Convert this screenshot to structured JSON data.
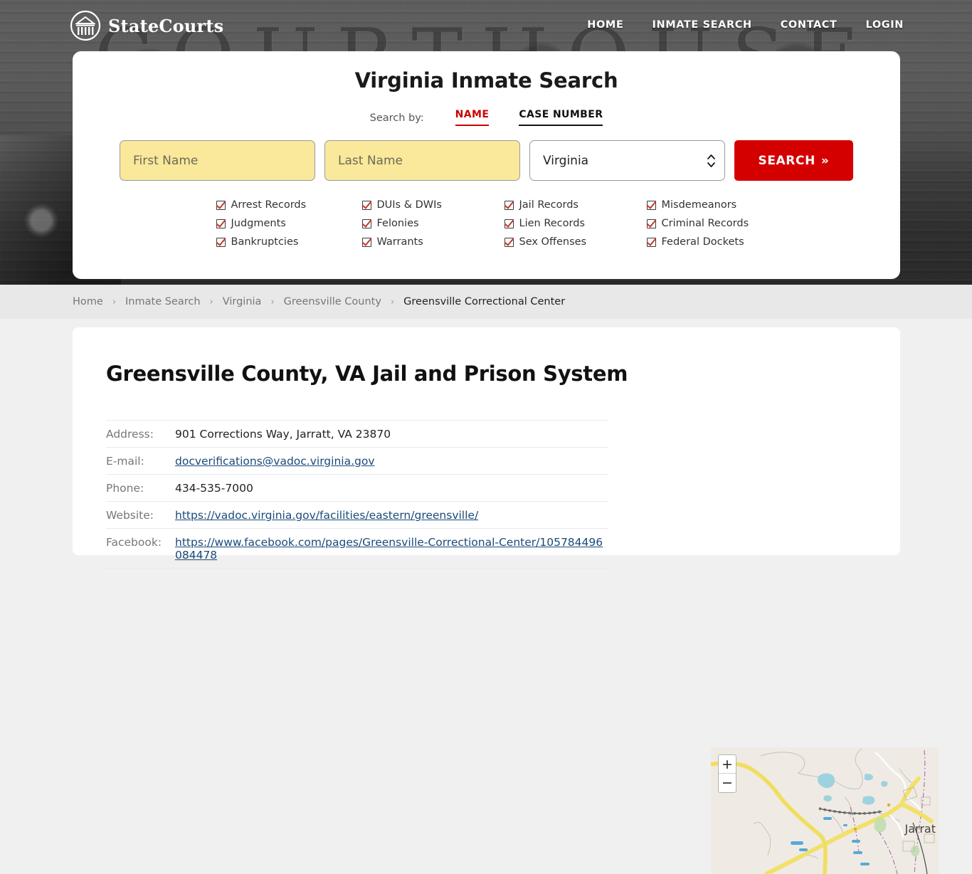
{
  "brand": {
    "name": "StateCourts",
    "logo_icon": "courthouse-circle-icon"
  },
  "topnav": [
    {
      "label": "HOME"
    },
    {
      "label": "INMATE SEARCH"
    },
    {
      "label": "CONTACT"
    },
    {
      "label": "LOGIN"
    }
  ],
  "search": {
    "title": "Virginia Inmate Search",
    "search_by_label": "Search by:",
    "tabs": [
      {
        "label": "NAME",
        "active": true,
        "color": "#cc0000"
      },
      {
        "label": "CASE NUMBER",
        "active": false,
        "color": "#111111"
      }
    ],
    "first_name_placeholder": "First Name",
    "first_name_value": "",
    "last_name_placeholder": "Last Name",
    "last_name_value": "",
    "state_selected": "Virginia",
    "state_options": [
      "Virginia"
    ],
    "submit_label": "SEARCH",
    "submit_chevron": "»",
    "field_color": "#fae89b",
    "button_color": "#d40000"
  },
  "record_types": [
    {
      "label": "Arrest Records",
      "checked": true
    },
    {
      "label": "DUIs & DWIs",
      "checked": true
    },
    {
      "label": "Jail Records",
      "checked": true
    },
    {
      "label": "Misdemeanors",
      "checked": true
    },
    {
      "label": "Judgments",
      "checked": true
    },
    {
      "label": "Felonies",
      "checked": true
    },
    {
      "label": "Lien Records",
      "checked": true
    },
    {
      "label": "Criminal Records",
      "checked": true
    },
    {
      "label": "Bankruptcies",
      "checked": true
    },
    {
      "label": "Warrants",
      "checked": true
    },
    {
      "label": "Sex Offenses",
      "checked": true
    },
    {
      "label": "Federal Dockets",
      "checked": true
    }
  ],
  "breadcrumb": [
    {
      "label": "Home",
      "current": false
    },
    {
      "label": "Inmate Search",
      "current": false
    },
    {
      "label": "Virginia",
      "current": false
    },
    {
      "label": "Greensville County",
      "current": false
    },
    {
      "label": "Greensville Correctional Center",
      "current": true
    }
  ],
  "breadcrumb_separator": "›",
  "page": {
    "title": "Greensville County, VA Jail and Prison System"
  },
  "facility_info": [
    {
      "label": "Address:",
      "value": "901 Corrections Way, Jarratt, VA 23870",
      "is_link": false
    },
    {
      "label": "E-mail:",
      "value": "docverifications@vadoc.virginia.gov",
      "is_link": true
    },
    {
      "label": "Phone:",
      "value": "434-535-7000",
      "is_link": false
    },
    {
      "label": "Website:",
      "value": "https://vadoc.virginia.gov/facilities/eastern/greensville/",
      "is_link": true
    },
    {
      "label": "Facebook:",
      "value": "https://www.facebook.com/pages/Greensville-Correctional-Center/105784496084478",
      "is_link": true
    }
  ],
  "map": {
    "place_label": "Jarrat",
    "zoom_in_label": "+",
    "zoom_out_label": "−"
  }
}
